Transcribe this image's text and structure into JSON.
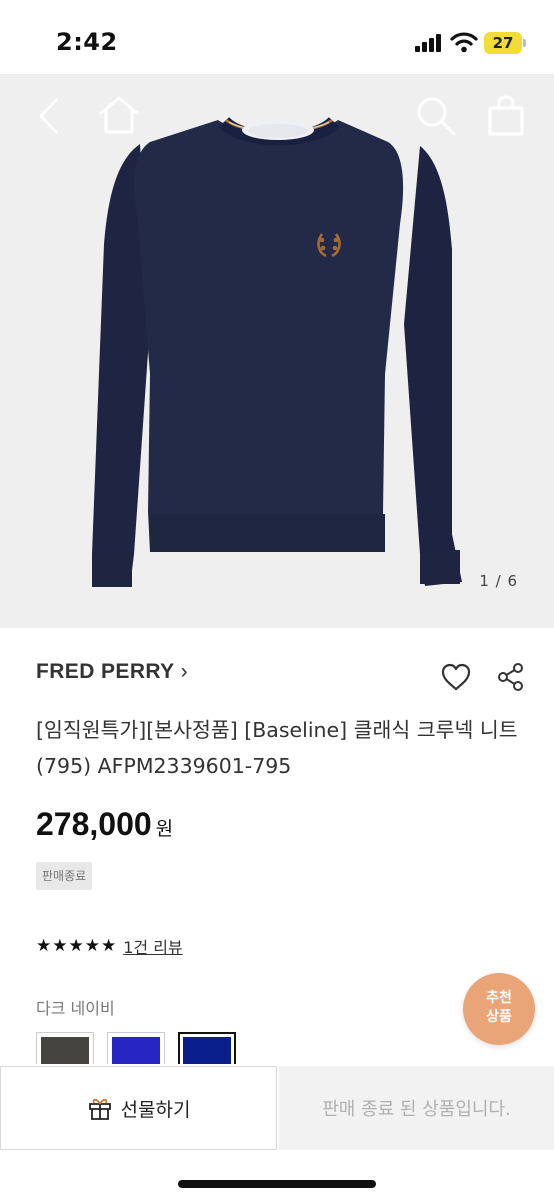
{
  "status_bar": {
    "time": "2:42",
    "battery": "27"
  },
  "gallery": {
    "counter": "1 / 6"
  },
  "product": {
    "brand": "FRED PERRY",
    "title": "[임직원특가][본사정품] [Baseline] 클래식 크루넥 니트 (795) AFPM2339601-795",
    "price": "278,000",
    "currency": "원",
    "status_badge": "판매종료",
    "stars": "★★★★★",
    "review_link": "1건 리뷰",
    "color_name": "다크 네이비"
  },
  "swatches": [
    {
      "color": "#45443f"
    },
    {
      "color": "#2626c4"
    },
    {
      "color": "#0a1f8c"
    }
  ],
  "recommend": {
    "line1": "추천",
    "line2": "상품"
  },
  "bottom": {
    "gift_label": "선물하기",
    "sold_out_label": "판매 종료 된 상품입니다."
  }
}
